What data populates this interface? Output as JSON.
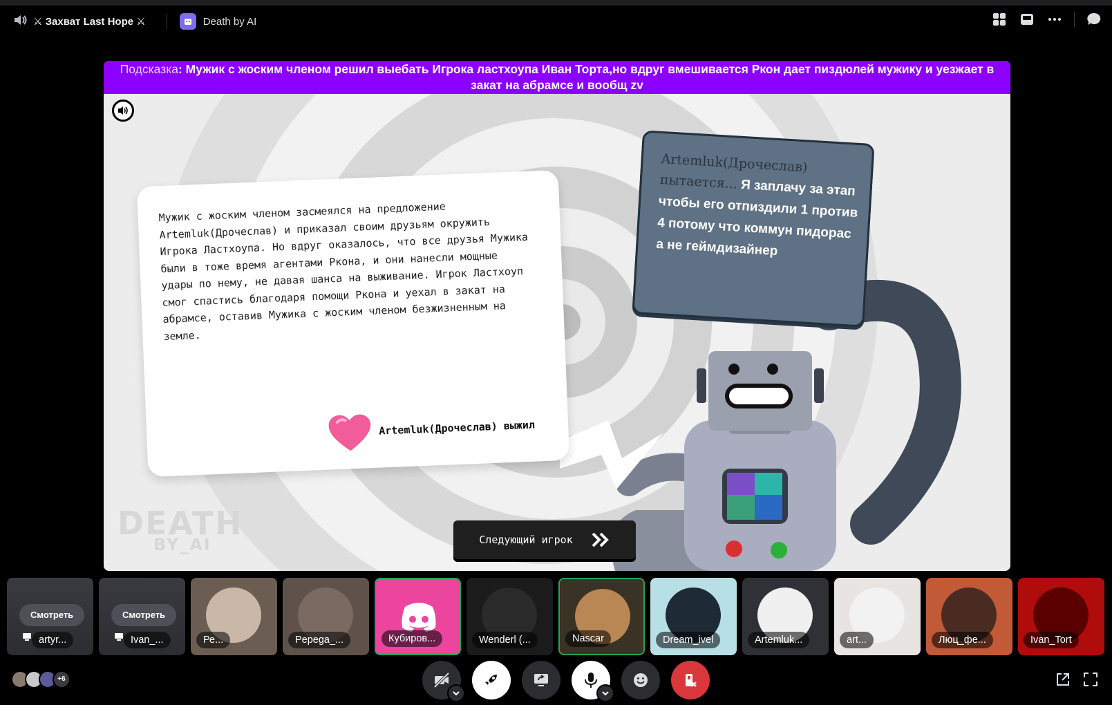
{
  "topbar": {
    "channel_title": "⚔ Захват Last Hope ⚔",
    "app_name": "Death by AI"
  },
  "game": {
    "hint_label": "Подсказка",
    "hint_text": ": Мужик с жоским членом решил выебать Игрока ластхоупа Иван Торта,но вдруг вмешивается Ркон дает пиздюлей мужику и уезжает в закат на абрамсе и вообщ zv",
    "story": "Мужик с жоским членом засмеялся на предложение Artemluk(Дрочеслав) и приказал своим друзьям окружить Игрока Ластхоупа. Но вдруг оказалось, что все друзья Мужика были в тоже время агентами Ркона, и они нанесли мощные удары по нему, не давая шанса на выживание. Игрок Ластхоуп смог спастись благодаря помощи Ркона и уехал в закат на абрамсе, оставив Мужика с жоским членом безжизненным на земле.",
    "result": "Artemluk(Дрочеслав) выжил",
    "speech_player": "Artemluk(Дрочеслав) пытается...",
    "speech_text": " Я заплачу за этап чтобы его отпиздили 1 против 4 потому что коммун пидорас а не геймдизайнер",
    "next_button": "Следующий игрок",
    "logo_line1": "DEATH",
    "logo_line2": "BY_AI"
  },
  "participants": [
    {
      "name": "artyr...",
      "streaming": true,
      "watch_label": "Смотреть",
      "color": "#3b3d44"
    },
    {
      "name": "Ivan_...",
      "streaming": true,
      "watch_label": "Смотреть",
      "color": "#3b3d44"
    },
    {
      "name": "Ре...",
      "color": "#c9b8a8",
      "bg": "#6b5d52"
    },
    {
      "name": "Pepega_...",
      "color": "#7a6a62",
      "bg": "#5e524a"
    },
    {
      "name": "Кубиров...",
      "color": "#ffffff",
      "bg": "#eb459e",
      "speaking": true
    },
    {
      "name": "Wenderl (...",
      "color": "#2a2a2a",
      "bg": "#1b1b1b"
    },
    {
      "name": "Nascar",
      "color": "#b88754",
      "bg": "#3a3224",
      "speaking": true
    },
    {
      "name": "Dream_ivel",
      "color": "#1e2a35",
      "bg": "#b7dfe6"
    },
    {
      "name": "Artemluk...",
      "color": "#f0f0f0",
      "bg": "#2f3136"
    },
    {
      "name": "art...",
      "color": "#f2f2f2",
      "bg": "#e8e4e2"
    },
    {
      "name": "Люц_фе...",
      "color": "#4a2b22",
      "bg": "#c25a38"
    },
    {
      "name": "Ivan_Tort",
      "color": "#5b0000",
      "bg": "#b00c0c"
    }
  ],
  "bottom": {
    "more_count": "+6"
  },
  "colors": {
    "hint_bar": "#8c00ff",
    "speaking_border": "#23a55a",
    "leave_button": "#da373c"
  }
}
